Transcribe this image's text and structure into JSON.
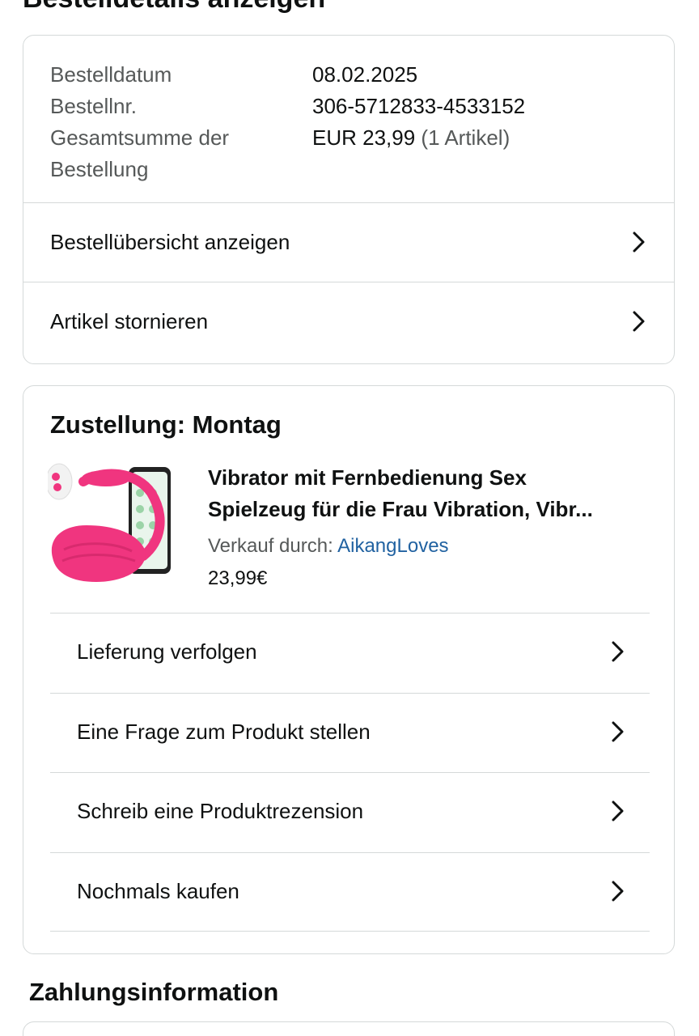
{
  "page": {
    "title": "Bestelldetails anzeigen"
  },
  "summary": {
    "rows": [
      {
        "label": "Bestelldatum",
        "value": "08.02.2025"
      },
      {
        "label": "Bestellnr.",
        "value": "306-5712833-4533152"
      },
      {
        "label": "Gesamtsumme der Bestellung",
        "value": "EUR 23,99",
        "count": "(1 Artikel)"
      }
    ],
    "links": [
      {
        "label": "Bestellübersicht anzeigen",
        "icon": "chevron-right-icon"
      },
      {
        "label": "Artikel stornieren",
        "icon": "chevron-right-icon"
      }
    ]
  },
  "delivery": {
    "title": "Zustellung: Montag",
    "product": {
      "title_line1": "Vibrator mit Fernbedienung Sex",
      "title_line2": "Spielzeug für die Frau Vibration, Vibr...",
      "seller_prefix": "Verkauf durch:",
      "seller_name": "AikangLoves",
      "price": "23,99€",
      "image_icon": "product-image"
    },
    "actions": [
      {
        "label": "Lieferung verfolgen",
        "icon": "chevron-right-icon"
      },
      {
        "label": "Eine Frage zum Produkt stellen",
        "icon": "chevron-right-icon"
      },
      {
        "label": "Schreib eine Produktrezension",
        "icon": "chevron-right-icon"
      },
      {
        "label": "Nochmals kaufen",
        "icon": "chevron-right-icon"
      }
    ]
  },
  "payment": {
    "title": "Zahlungsinformation"
  },
  "colors": {
    "text": "#0f1111",
    "muted": "#565959",
    "link": "#2162a1",
    "border": "#d5d9d9",
    "product_pink": "#f0357f"
  }
}
